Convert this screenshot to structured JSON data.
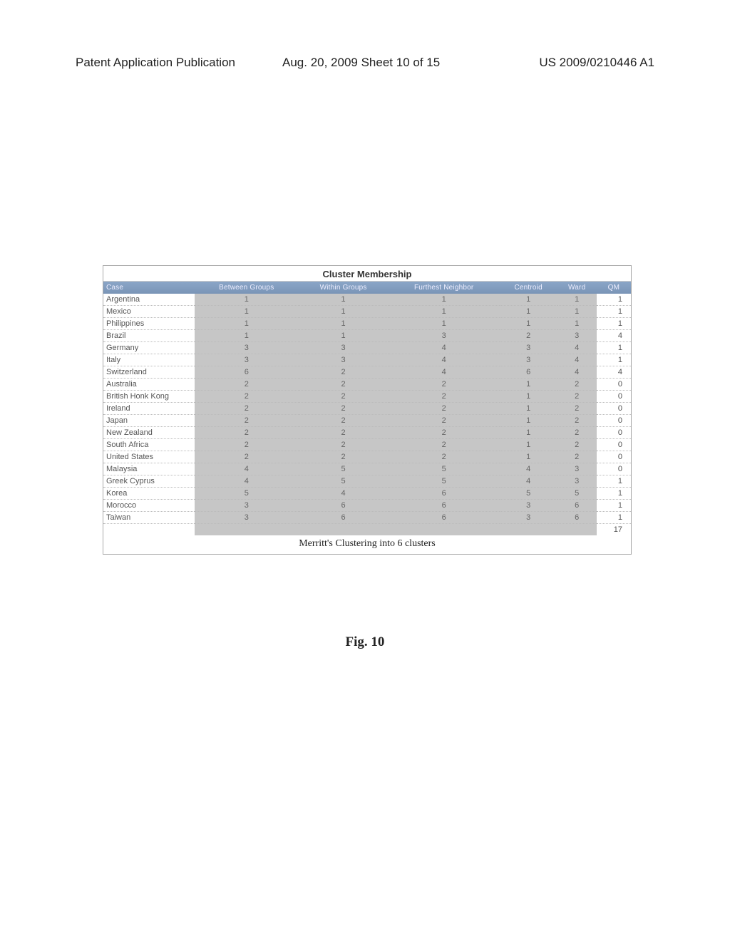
{
  "header": {
    "left": "Patent Application Publication",
    "center": "Aug. 20, 2009  Sheet 10 of 15",
    "right": "US 2009/0210446 A1"
  },
  "table": {
    "title": "Cluster Membership",
    "columns": [
      "Case",
      "Between Groups",
      "Within Groups",
      "Furthest Neighbor",
      "Centroid",
      "Ward",
      "QM"
    ],
    "rows": [
      {
        "case": "Argentina",
        "bg": "1",
        "wg": "1",
        "fn": "1",
        "ce": "1",
        "wa": "1",
        "qm": "1"
      },
      {
        "case": "Mexico",
        "bg": "1",
        "wg": "1",
        "fn": "1",
        "ce": "1",
        "wa": "1",
        "qm": "1"
      },
      {
        "case": "Philippines",
        "bg": "1",
        "wg": "1",
        "fn": "1",
        "ce": "1",
        "wa": "1",
        "qm": "1"
      },
      {
        "case": "Brazil",
        "bg": "1",
        "wg": "1",
        "fn": "3",
        "ce": "2",
        "wa": "3",
        "qm": "4"
      },
      {
        "case": "Germany",
        "bg": "3",
        "wg": "3",
        "fn": "4",
        "ce": "3",
        "wa": "4",
        "qm": "1"
      },
      {
        "case": "Italy",
        "bg": "3",
        "wg": "3",
        "fn": "4",
        "ce": "3",
        "wa": "4",
        "qm": "1"
      },
      {
        "case": "Switzerland",
        "bg": "6",
        "wg": "2",
        "fn": "4",
        "ce": "6",
        "wa": "4",
        "qm": "4"
      },
      {
        "case": "Australia",
        "bg": "2",
        "wg": "2",
        "fn": "2",
        "ce": "1",
        "wa": "2",
        "qm": "0"
      },
      {
        "case": "British Honk Kong",
        "bg": "2",
        "wg": "2",
        "fn": "2",
        "ce": "1",
        "wa": "2",
        "qm": "0"
      },
      {
        "case": "Ireland",
        "bg": "2",
        "wg": "2",
        "fn": "2",
        "ce": "1",
        "wa": "2",
        "qm": "0"
      },
      {
        "case": "Japan",
        "bg": "2",
        "wg": "2",
        "fn": "2",
        "ce": "1",
        "wa": "2",
        "qm": "0"
      },
      {
        "case": "New Zealand",
        "bg": "2",
        "wg": "2",
        "fn": "2",
        "ce": "1",
        "wa": "2",
        "qm": "0"
      },
      {
        "case": "South Africa",
        "bg": "2",
        "wg": "2",
        "fn": "2",
        "ce": "1",
        "wa": "2",
        "qm": "0"
      },
      {
        "case": "United States",
        "bg": "2",
        "wg": "2",
        "fn": "2",
        "ce": "1",
        "wa": "2",
        "qm": "0"
      },
      {
        "case": "Malaysia",
        "bg": "4",
        "wg": "5",
        "fn": "5",
        "ce": "4",
        "wa": "3",
        "qm": "0"
      },
      {
        "case": "Greek Cyprus",
        "bg": "4",
        "wg": "5",
        "fn": "5",
        "ce": "4",
        "wa": "3",
        "qm": "1"
      },
      {
        "case": "Korea",
        "bg": "5",
        "wg": "4",
        "fn": "6",
        "ce": "5",
        "wa": "5",
        "qm": "1"
      },
      {
        "case": "Morocco",
        "bg": "3",
        "wg": "6",
        "fn": "6",
        "ce": "3",
        "wa": "6",
        "qm": "1"
      },
      {
        "case": "Taiwan",
        "bg": "3",
        "wg": "6",
        "fn": "6",
        "ce": "3",
        "wa": "6",
        "qm": "1"
      }
    ],
    "total_qm": "17",
    "caption": "Merritt's Clustering into 6 clusters"
  },
  "figure_label": "Fig. 10"
}
